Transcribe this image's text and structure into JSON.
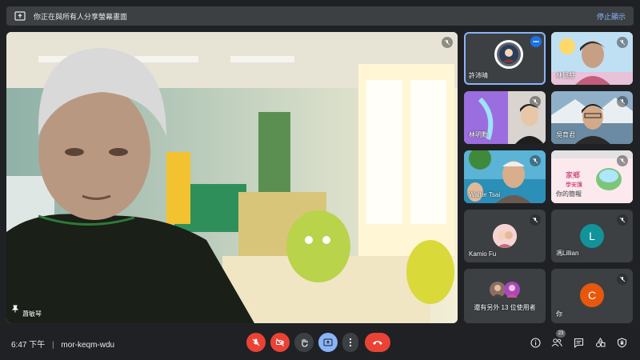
{
  "banner": {
    "text": "你正在與所有人分享螢幕畫面",
    "stop_label": "停止顯示"
  },
  "main_tile": {
    "name": "蕭敏琴"
  },
  "tiles": [
    {
      "name": "許沛晴"
    },
    {
      "name": "林佩芬"
    },
    {
      "name": "林明勳"
    },
    {
      "name": "吳育君"
    },
    {
      "name": "Walter Tsai"
    },
    {
      "name": "你的簡報"
    },
    {
      "name": "Kamio Fu"
    },
    {
      "name": "馮Lillian",
      "initial": "L"
    },
    {
      "name": "還有另外 13 位使用者"
    },
    {
      "name": "你",
      "initial": "C"
    }
  ],
  "presentation_thumb_text": "家鄉\n學安護",
  "bottom": {
    "time": "6:47 下午",
    "meeting_code": "mor-keqm-wdu",
    "participant_count": "23"
  },
  "colors": {
    "hangup": "#ea4335",
    "muted": "#ea4335",
    "present_active": "#8ab4f8",
    "avatar_l": "#12939a",
    "avatar_c": "#e8580c"
  }
}
